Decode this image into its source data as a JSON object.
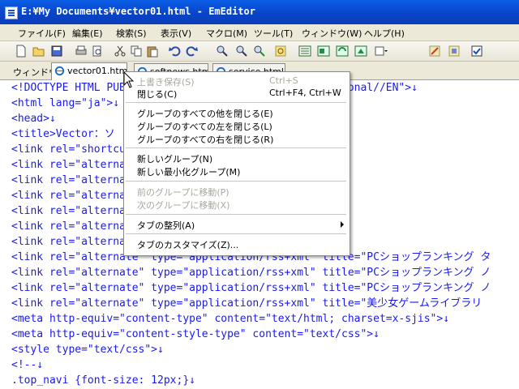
{
  "window": {
    "title": "E:¥My Documents¥vector01.html - EmEditor"
  },
  "menu": [
    "ファイル(F)",
    "編集(E)",
    "検索(S)",
    "表示(V)",
    "マクロ(M)",
    "ツール(T)",
    "ウィンドウ(W)",
    "ヘルプ(H)"
  ],
  "toolbar_icons": [
    "new-icon",
    "open-icon",
    "save-icon",
    "print-icon",
    "print-preview-icon",
    "cut-icon",
    "copy-icon",
    "paste-icon",
    "undo-icon",
    "redo-icon",
    "find-icon",
    "find-next-icon",
    "find-prev-icon",
    "highlight-icon",
    "window-list-icon",
    "window-icon-2",
    "window-icon-3",
    "window-icon-4",
    "dropdown-icon",
    "config-icon-1",
    "config-icon-2",
    "check-icon"
  ],
  "tabbar": {
    "label": "ウィンドウ",
    "tabs": [
      "vector01.htm",
      "softnews.html",
      "service.html"
    ]
  },
  "editor": {
    "lines": [
      [
        "<!DOCTYPE HTML PUBLIC \"-//W3C//DTD HTML 4.01 Transitional//EN\">↓"
      ],
      [
        "<html lang=\"ja\">↓"
      ],
      [
        "<head>↓"
      ],
      [
        "<title>Vector：ソ ... </title>↓"
      ],
      [
        "<link rel=\"shortcut icon\" ... type=\"image/x-icon\">↓"
      ],
      [
        "<link rel=\"alternate ... title=\"ベクターソフトニュース"
      ],
      [
        "<link rel=\"alternate ... title=\"週間総合ダウンロードラ"
      ],
      [
        "<link rel=\"alternate ... title=\"週間総合ダウンロードラ"
      ],
      [
        "<link rel=\"alternate ... title=\"PCショップ ニュース RSS"
      ],
      [
        "<link rel=\"alternate ... title=\"PCショップ新着商品 （ダ"
      ],
      [
        "<link rel=\"alternate ... title=\"PCショップランキング ダ"
      ],
      [
        "<link rel=\"alternate\" type=\"application/rss+xml\" title=\"PCショップランキング タ"
      ],
      [
        "<link rel=\"alternate\" type=\"application/rss+xml\" title=\"PCショップランキング ノ"
      ],
      [
        "<link rel=\"alternate\" type=\"application/rss+xml\" title=\"PCショップランキング ノ"
      ],
      [
        "<link rel=\"alternate\" type=\"application/rss+xml\" title=\"美少女ゲームライブラリ"
      ],
      [
        "<meta http-equiv=\"content-type\" content=\"text/html; charset=x-sjis\">↓"
      ],
      [
        "<meta http-equiv=\"content-style-type\" content=\"text/css\">↓"
      ],
      [
        "<style type=\"text/css\">↓"
      ],
      [
        "<!--↓"
      ],
      [
        ".top_navi   {font-size: 12px;}↓"
      ]
    ]
  },
  "context_menu": {
    "items": [
      {
        "label": "上書き保存(S)",
        "shortcut": "Ctrl+S",
        "disabled": true
      },
      {
        "label": "閉じる(C)",
        "shortcut": "Ctrl+F4, Ctrl+W",
        "disabled": false
      },
      {
        "label": "グループのすべての他を閉じる(E)",
        "shortcut": "",
        "disabled": false
      },
      {
        "label": "グループのすべての左を閉じる(L)",
        "shortcut": "",
        "disabled": false
      },
      {
        "label": "グループのすべての右を閉じる(R)",
        "shortcut": "",
        "disabled": false
      },
      {
        "label": "新しいグループ(N)",
        "shortcut": "",
        "disabled": false
      },
      {
        "label": "新しい最小化グループ(M)",
        "shortcut": "",
        "disabled": false
      },
      {
        "label": "前のグループに移動(P)",
        "shortcut": "",
        "disabled": true
      },
      {
        "label": "次のグループに移動(X)",
        "shortcut": "",
        "disabled": true
      },
      {
        "label": "タブの整列(A)",
        "shortcut": "",
        "disabled": false,
        "submenu": true
      },
      {
        "label": "タブのカスタマイズ(Z)...",
        "shortcut": "",
        "disabled": false
      }
    ]
  },
  "colors": {
    "tag": "#1a1aee",
    "attr": "#ee1a8a",
    "title_bar": "#0842c7"
  }
}
